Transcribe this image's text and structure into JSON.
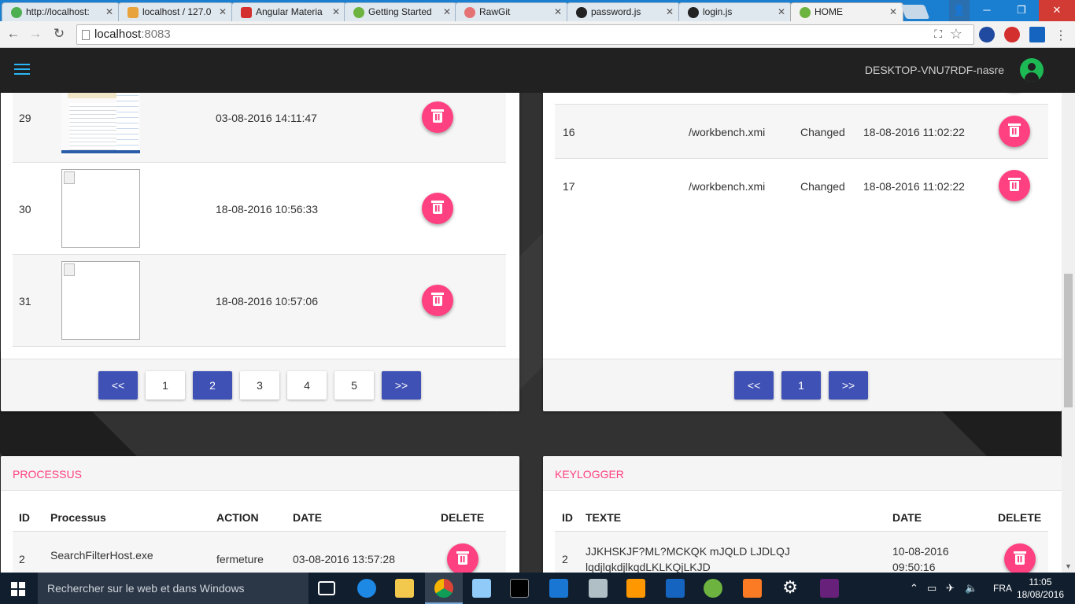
{
  "browser": {
    "tabs": [
      {
        "title": "http://localhost:",
        "icon": "page-icon",
        "color": "#4caf50"
      },
      {
        "title": "localhost / 127.0",
        "icon": "pma-icon",
        "color": "#e8a33d"
      },
      {
        "title": "Angular Materia",
        "icon": "angular-icon",
        "color": "#d32f2f"
      },
      {
        "title": "Getting Started",
        "icon": "spring-icon",
        "color": "#6db33f"
      },
      {
        "title": "RawGit",
        "icon": "rawgit-icon",
        "color": "#e57373"
      },
      {
        "title": "password.js",
        "icon": "github-icon",
        "color": "#222222"
      },
      {
        "title": "login.js",
        "icon": "github-icon",
        "color": "#222222"
      },
      {
        "title": "HOME",
        "icon": "spring-icon",
        "color": "#6db33f"
      }
    ],
    "address": {
      "host": "localhost",
      "port": ":8083"
    }
  },
  "appbar": {
    "hostname": "DESKTOP-VNU7RDF-nasre"
  },
  "screenshots": {
    "rows": [
      {
        "id": "29",
        "date": "03-08-2016 14:11:47",
        "image": "screenshot"
      },
      {
        "id": "30",
        "date": "18-08-2016 10:56:33",
        "image": "broken"
      },
      {
        "id": "31",
        "date": "18-08-2016 10:57:06",
        "image": "broken"
      }
    ],
    "pagination": {
      "prev": "<<",
      "pages": [
        "1",
        "2",
        "3",
        "4",
        "5"
      ],
      "current": "2",
      "next": ">>"
    }
  },
  "files": {
    "rows": [
      {
        "id": "16",
        "path": "/workbench.xmi",
        "action": "Changed",
        "date": "18-08-2016 11:02:22"
      },
      {
        "id": "17",
        "path": "/workbench.xmi",
        "action": "Changed",
        "date": "18-08-2016 11:02:22"
      }
    ],
    "pagination": {
      "prev": "<<",
      "pages": [
        "1"
      ],
      "current": "1",
      "next": ">>"
    }
  },
  "processus": {
    "title": "PROCESSUS",
    "headers": {
      "id": "ID",
      "name": "Processus",
      "action": "ACTION",
      "date": "DATE",
      "delete": "DELETE"
    },
    "rows": [
      {
        "id": "2",
        "name": "SearchFilterHost.exe",
        "action": "fermeture",
        "date": "03-08-2016 13:57:28"
      }
    ]
  },
  "keylogger": {
    "title": "KEYLOGGER",
    "headers": {
      "id": "ID",
      "text": "TEXTE",
      "date": "DATE",
      "delete": "DELETE"
    },
    "rows": [
      {
        "id": "2",
        "text_line1": "JJKHSKJF?ML?MCKQK mJQLD LJDLQJ",
        "text_line2": "lqdjlqkdjlkqdLKLKQjLKJD",
        "date_line1": "10-08-2016",
        "date_line2": "09:50:16"
      }
    ]
  },
  "colors": {
    "primary": "#3f51b5",
    "accent": "#ff4081",
    "appbar": "#212121",
    "avatar": "#1db954"
  },
  "taskbar": {
    "search_placeholder": "Rechercher sur le web et dans Windows",
    "language": "FRA",
    "time": "11:05",
    "date": "18/08/2016"
  }
}
